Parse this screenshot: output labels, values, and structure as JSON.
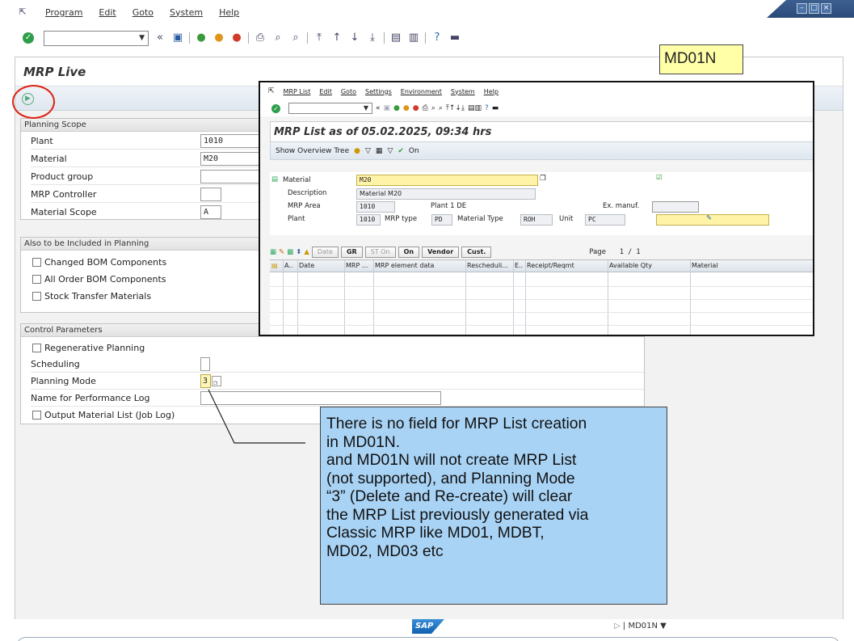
{
  "menu": [
    "Program",
    "Edit",
    "Goto",
    "System",
    "Help"
  ],
  "app": {
    "title": "MRP Live"
  },
  "groups": {
    "planning_scope": {
      "title": "Planning Scope",
      "plant_label": "Plant",
      "plant_value": "1010",
      "material_label": "Material",
      "material_value": "M20",
      "product_group_label": "Product group",
      "mrp_controller_label": "MRP Controller",
      "material_scope_label": "Material Scope",
      "material_scope_value": "A"
    },
    "also_included": {
      "title": "Also to be Included in Planning",
      "items": [
        "Changed BOM Components",
        "All Order BOM Components",
        "Stock Transfer Materials"
      ]
    },
    "control": {
      "title": "Control Parameters",
      "regenerative_label": "Regenerative Planning",
      "scheduling_label": "Scheduling",
      "planning_mode_label": "Planning Mode",
      "planning_mode_value": "3",
      "perf_log_label": "Name for Performance Log",
      "output_list_label": "Output Material List (Job Log)"
    }
  },
  "annotation_label": "MD01N",
  "overlay": {
    "menu": [
      "MRP List",
      "Edit",
      "Goto",
      "Settings",
      "Environment",
      "System",
      "Help"
    ],
    "title": "MRP List as of 05.02.2025, 09:34 hrs",
    "toolbar": {
      "overview_tree": "Show Overview Tree",
      "on": "On"
    },
    "header": {
      "material_label": "Material",
      "material_value": "M20",
      "description_label": "Description",
      "description_value": "Material M20",
      "mrp_area_label": "MRP Area",
      "mrp_area_value": "1010",
      "mrp_area_text": "Plant 1 DE",
      "plant_label": "Plant",
      "plant_value": "1010",
      "mrp_type_label": "MRP type",
      "mrp_type_value": "PD",
      "material_type_label": "Material Type",
      "material_type_value": "ROH",
      "unit_label": "Unit",
      "unit_value": "PC",
      "ex_manuf_label": "Ex. manuf."
    },
    "grid_toolbar": {
      "date": "Date",
      "gr": "GR",
      "st_on": "ST On",
      "on": "On",
      "vendor": "Vendor",
      "cust": "Cust.",
      "page_label": "Page",
      "page_value": "1 / 1"
    },
    "columns": [
      "A..",
      "Date",
      "MRP ...",
      "MRP element data",
      "Rescheduli...",
      "E..",
      "Receipt/Reqmt",
      "Available Qty",
      "Material"
    ]
  },
  "callout": {
    "lines": [
      "There is no field for MRP List creation",
      "in MD01N.",
      "and MD01N will not create MRP List",
      "(not supported), and Planning Mode",
      "“3” (Delete and Re-create) will clear",
      "the MRP List previously generated via",
      "Classic MRP like MD01, MDBT,",
      "MD02, MD03 etc"
    ]
  },
  "status": {
    "logo": "SAP",
    "tcode": "MD01N"
  }
}
